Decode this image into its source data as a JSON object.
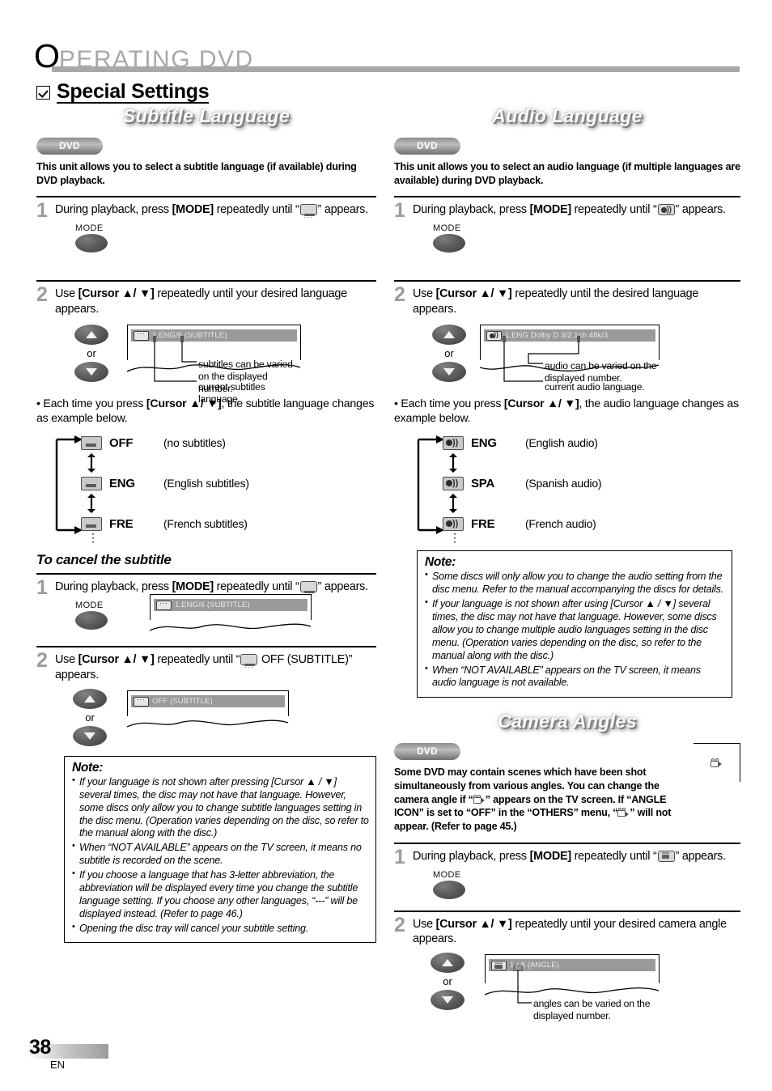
{
  "header": {
    "cap": "O",
    "rest": "PERATING  DVD"
  },
  "page_title": "Special Settings",
  "footer": {
    "page_number": "38",
    "language_code": "EN"
  },
  "sections": {
    "subtitle_language": {
      "banner": "Subtitle Language",
      "disc_badge": "DVD",
      "intro": "This unit allows you to select a subtitle language (if available) during DVD playback.",
      "step1": {
        "number": "1",
        "text_before": "During playback, press ",
        "key": "[MODE]",
        "text_after": " repeatedly until “",
        "text_end": "” appears.",
        "button_label": "MODE"
      },
      "step2": {
        "number": "2",
        "text_before": "Use ",
        "key": "[Cursor ▲/ ▼]",
        "text_after": " repeatedly until your desired language appears.",
        "or_label": "or",
        "osd_text": "1.ENG/6  (SUBTITLE)",
        "callout_top": "subtitles can be varied on the displayed number.",
        "callout_bottom": "current subtitles language."
      },
      "cycle_note_before": "• Each time you press ",
      "cycle_note_key": "[Cursor ▲/ ▼]",
      "cycle_note_after": ", the subtitle language changes as example below.",
      "cycle": [
        {
          "code": "OFF",
          "desc": "(no subtitles)"
        },
        {
          "code": "ENG",
          "desc": "(English subtitles)"
        },
        {
          "code": "FRE",
          "desc": "(French subtitles)"
        }
      ]
    },
    "cancel_subtitle": {
      "heading": "To cancel the subtitle",
      "step1": {
        "number": "1",
        "text_before": "During playback, press ",
        "key": "[MODE]",
        "text_after": " repeatedly until “",
        "text_end": "” appears.",
        "button_label": "MODE",
        "osd_text": "1.ENG/6  (SUBTITLE)"
      },
      "step2": {
        "number": "2",
        "text_before": "Use ",
        "key": "[Cursor ▲/ ▼]",
        "text_mid": " repeatedly until “",
        "text_after": " OFF (SUBTITLE)” appears.",
        "or_label": "or",
        "osd_text": "OFF  (SUBTITLE)"
      },
      "note": {
        "title": "Note:",
        "items": [
          "If your language is not shown after pressing [Cursor ▲ / ▼] several times, the disc may not have that language. However, some discs only allow you to change subtitle languages setting in the disc menu. (Operation varies depending on the disc, so refer to the manual along with the disc.)",
          "When “NOT AVAILABLE” appears on the TV screen, it means no subtitle is recorded on the scene.",
          "If you choose a language that has 3-letter abbreviation, the abbreviation will be displayed every time you change the subtitle language setting. If you choose any other languages, “---” will be displayed instead. (Refer to page 46.)",
          "Opening the disc tray will cancel your subtitle setting."
        ]
      }
    },
    "audio_language": {
      "banner": "Audio Language",
      "disc_badge": "DVD",
      "intro": "This unit allows you to select an audio language (if multiple languages are available) during DVD playback.",
      "step1": {
        "number": "1",
        "text_before": "During playback, press ",
        "key": "[MODE]",
        "text_after": " repeatedly until “",
        "text_end": "” appears.",
        "button_label": "MODE"
      },
      "step2": {
        "number": "2",
        "text_before": "Use ",
        "key": "[Cursor ▲/ ▼]",
        "text_after": " repeatedly until the desired language appears.",
        "or_label": "or",
        "osd_text": "1.ENG Dolby D 3/2.1ch  48k/3",
        "callout_top": "audio can be varied on the displayed number.",
        "callout_bottom": "current audio language."
      },
      "cycle_note_before": "• Each time you press ",
      "cycle_note_key": "[Cursor ▲/ ▼]",
      "cycle_note_after": ", the audio language changes as example below.",
      "cycle": [
        {
          "code": "ENG",
          "desc": "(English audio)"
        },
        {
          "code": "SPA",
          "desc": "(Spanish audio)"
        },
        {
          "code": "FRE",
          "desc": "(French audio)"
        }
      ],
      "note": {
        "title": "Note:",
        "items": [
          "Some discs will only allow you to change the audio setting from the disc menu. Refer to the manual accompanying the discs for details.",
          "If your language is not shown after using [Cursor ▲ / ▼] several times, the disc may not have that language. However, some discs allow you to change multiple audio languages setting in the disc menu. (Operation varies depending on the disc, so refer to the manual along with the disc.)",
          "When “NOT AVAILABLE” appears on the TV screen, it means audio language is not available."
        ]
      }
    },
    "camera_angles": {
      "banner": "Camera Angles",
      "disc_badge": "DVD",
      "intro_1": "Some DVD may contain scenes which have been shot simultaneously from various angles. You can change the camera angle if “",
      "intro_2": "” appears on the TV screen. If “ANGLE ICON” is set to “OFF” in the “OTHERS” menu, “",
      "intro_3": "” will not appear. (Refer to page 45.)",
      "step1": {
        "number": "1",
        "text_before": "During playback, press ",
        "key": "[MODE]",
        "text_after": " repeatedly until “",
        "text_end": "” appears.",
        "button_label": "MODE"
      },
      "step2": {
        "number": "2",
        "text_before": "Use ",
        "key": "[Cursor ▲/ ▼]",
        "text_after": " repeatedly until your desired camera angle appears.",
        "or_label": "or",
        "osd_text": "1 / 8  (ANGLE)",
        "callout": "angles can be varied on the displayed number."
      }
    }
  }
}
